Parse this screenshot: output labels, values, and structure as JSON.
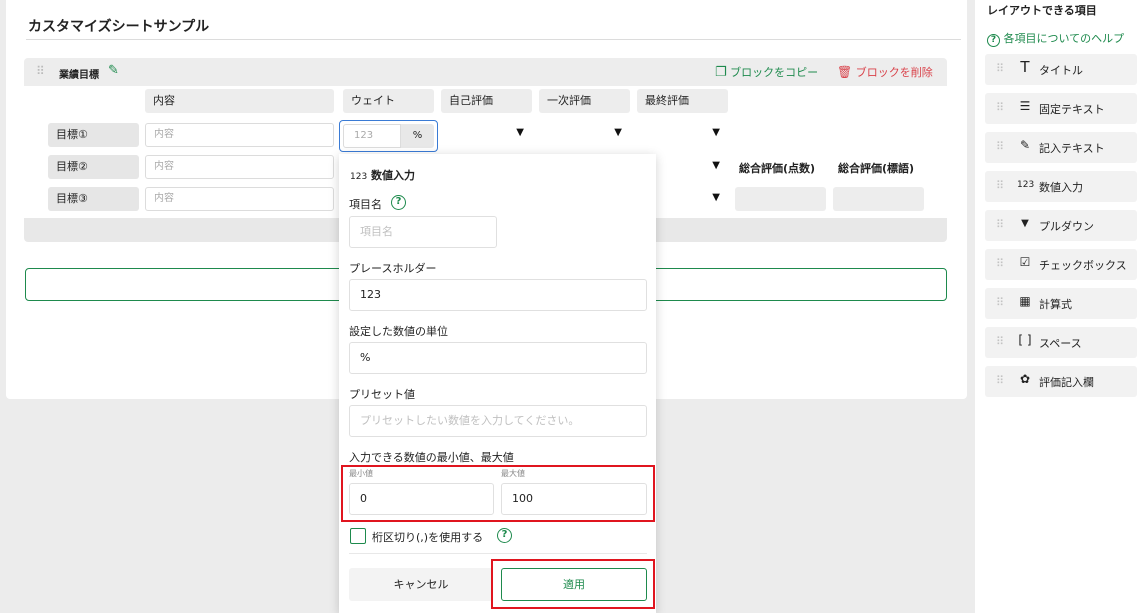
{
  "sheet_title": "カスタマイズシートサンプル",
  "block": {
    "name": "業績目標",
    "copy_label": "ブロックをコピー",
    "delete_label": "ブロックを削除",
    "columns": [
      "内容",
      "ウェイト",
      "自己評価",
      "一次評価",
      "最終評価"
    ],
    "score_headers": [
      "総合評価(点数)",
      "総合評価(標語)"
    ],
    "rows": [
      {
        "label": "目標①",
        "content_placeholder": "内容"
      },
      {
        "label": "目標②",
        "content_placeholder": "内容"
      },
      {
        "label": "目標③",
        "content_placeholder": "内容"
      }
    ],
    "weight_placeholder": "123",
    "weight_unit": "%"
  },
  "sidebar": {
    "title": "レイアウトできる項目",
    "help_link": "各項目についてのヘルプ",
    "items": [
      {
        "label": "タイトル",
        "icon": "title-T-icon"
      },
      {
        "label": "固定テキスト",
        "icon": "fixed-text-icon"
      },
      {
        "label": "記入テキスト",
        "icon": "text-entry-icon"
      },
      {
        "label": "数値入力",
        "icon": "number-123-icon"
      },
      {
        "label": "プルダウン",
        "icon": "dropdown-icon"
      },
      {
        "label": "チェックボックス",
        "icon": "checkbox-icon"
      },
      {
        "label": "計算式",
        "icon": "calculator-icon"
      },
      {
        "label": "スペース",
        "icon": "space-bracket-icon"
      },
      {
        "label": "評価記入欄",
        "icon": "evaluation-icon"
      }
    ]
  },
  "popup": {
    "heading_prefix": "123",
    "heading": "数値入力",
    "item_name_label": "項目名",
    "item_name_placeholder": "項目名",
    "placeholder_label": "プレースホルダー",
    "placeholder_value": "123",
    "unit_label": "設定した数値の単位",
    "unit_value": "%",
    "preset_label": "プリセット値",
    "preset_placeholder": "プリセットしたい数値を入力してください。",
    "range_label": "入力できる数値の最小値、最大値",
    "min_label": "最小値",
    "min_value": "0",
    "max_label": "最大値",
    "max_value": "100",
    "separator_label": "桁区切り(,)を使用する",
    "cancel_label": "キャンセル",
    "apply_label": "適用"
  },
  "colors": {
    "accent_green": "#1e8a4d",
    "delete_red": "#d9424a",
    "highlight_red": "#e0151f",
    "focus_blue": "#3a7bd5"
  }
}
